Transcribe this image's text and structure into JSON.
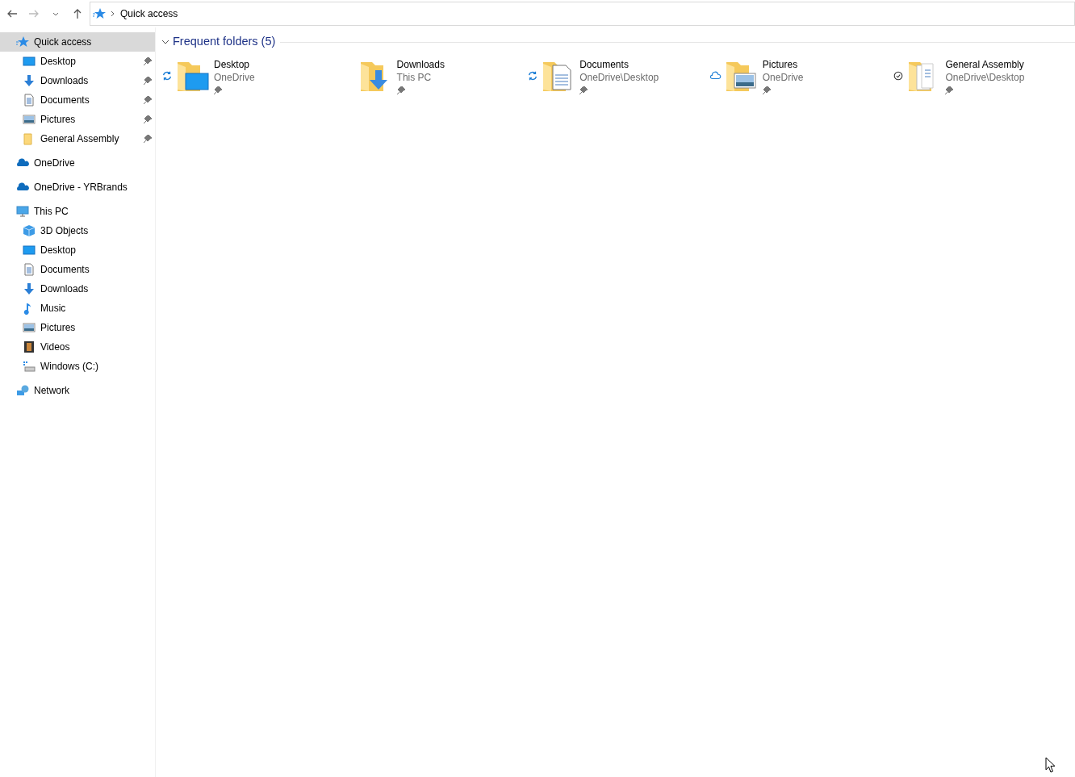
{
  "address_bar": {
    "path": "Quick access"
  },
  "sidebar": {
    "items": [
      {
        "label": "Quick access",
        "kind": "star",
        "selected": true,
        "children": [
          {
            "label": "Desktop",
            "kind": "desktop",
            "pinned": true
          },
          {
            "label": "Downloads",
            "kind": "downloads",
            "pinned": true
          },
          {
            "label": "Documents",
            "kind": "documents",
            "pinned": true
          },
          {
            "label": "Pictures",
            "kind": "pictures",
            "pinned": true
          },
          {
            "label": "General Assembly",
            "kind": "folder",
            "pinned": true
          }
        ]
      },
      {
        "label": "OneDrive",
        "kind": "cloud",
        "selected": false
      },
      {
        "label": "OneDrive - YRBrands",
        "kind": "cloud",
        "selected": false
      },
      {
        "label": "This PC",
        "kind": "pc",
        "selected": false,
        "children": [
          {
            "label": "3D Objects",
            "kind": "cube"
          },
          {
            "label": "Desktop",
            "kind": "desktop"
          },
          {
            "label": "Documents",
            "kind": "documents"
          },
          {
            "label": "Downloads",
            "kind": "downloads"
          },
          {
            "label": "Music",
            "kind": "music"
          },
          {
            "label": "Pictures",
            "kind": "pictures"
          },
          {
            "label": "Videos",
            "kind": "videos"
          },
          {
            "label": "Windows (C:)",
            "kind": "drive"
          }
        ]
      },
      {
        "label": "Network",
        "kind": "network",
        "selected": false
      }
    ]
  },
  "section": {
    "title": "Frequent folders (5)",
    "expanded": true
  },
  "folders": [
    {
      "name": "Desktop",
      "location": "OneDrive",
      "kind": "desktop",
      "status": {
        "kind": "syncing"
      },
      "pinned": true
    },
    {
      "name": "Downloads",
      "location": "This PC",
      "kind": "downloads",
      "pinned": true
    },
    {
      "name": "Documents",
      "location": "OneDrive\\Desktop",
      "kind": "documents",
      "status": {
        "kind": "syncing"
      },
      "pinned": true
    },
    {
      "name": "Pictures",
      "location": "OneDrive",
      "kind": "pictures",
      "status": {
        "kind": "cloud"
      },
      "pinned": true
    },
    {
      "name": "General Assembly",
      "location": "OneDrive\\Desktop",
      "kind": "files",
      "status": {
        "kind": "available"
      },
      "pinned": true
    }
  ]
}
